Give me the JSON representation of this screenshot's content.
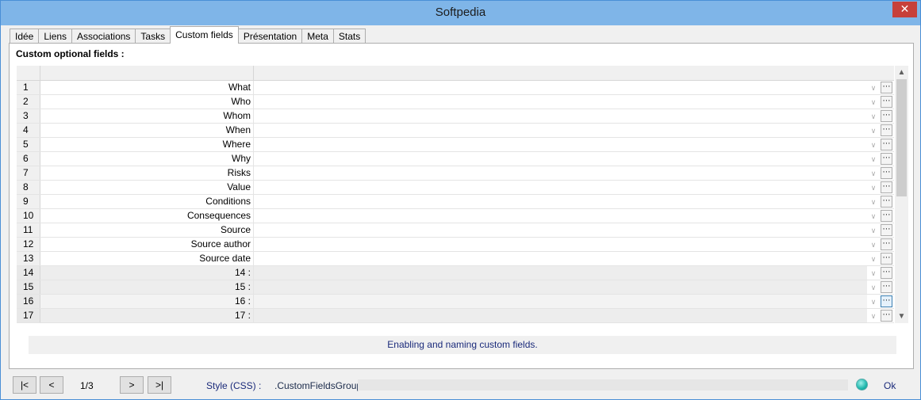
{
  "window": {
    "title": "Softpedia",
    "close_glyph": "✕"
  },
  "tabs": [
    {
      "label": "Idée",
      "active": false
    },
    {
      "label": "Liens",
      "active": false
    },
    {
      "label": "Associations",
      "active": false
    },
    {
      "label": "Tasks",
      "active": false
    },
    {
      "label": "Custom fields",
      "active": true
    },
    {
      "label": "Présentation",
      "active": false
    },
    {
      "label": "Meta",
      "active": false
    },
    {
      "label": "Stats",
      "active": false
    }
  ],
  "panel": {
    "section_label": "Custom optional fields :",
    "rows": [
      {
        "num": "1",
        "name": "What"
      },
      {
        "num": "2",
        "name": "Who"
      },
      {
        "num": "3",
        "name": "Whom"
      },
      {
        "num": "4",
        "name": "When"
      },
      {
        "num": "5",
        "name": "Where"
      },
      {
        "num": "6",
        "name": "Why"
      },
      {
        "num": "7",
        "name": "Risks"
      },
      {
        "num": "8",
        "name": "Value"
      },
      {
        "num": "9",
        "name": "Conditions"
      },
      {
        "num": "10",
        "name": "Consequences"
      },
      {
        "num": "11",
        "name": "Source"
      },
      {
        "num": "12",
        "name": "Source author"
      },
      {
        "num": "13",
        "name": "Source date"
      },
      {
        "num": "14",
        "name": "14 :"
      },
      {
        "num": "15",
        "name": "15 :"
      },
      {
        "num": "16",
        "name": "16 :"
      },
      {
        "num": "17",
        "name": "17 :"
      }
    ],
    "info_text": "Enabling and naming custom fields."
  },
  "bottom": {
    "first_label": "|<",
    "prev_label": "<",
    "page_info": "1/3",
    "next_label": ">",
    "last_label": ">|",
    "style_label": "Style (CSS) :",
    "style_value": ".CustomFieldsGroup",
    "ok_label": "Ok"
  },
  "icons": {
    "dropdown": "chevron-down-icon",
    "ellipsis": "ellipsis-icon",
    "scroll_up": "chevron-up-icon",
    "scroll_down": "chevron-down-icon",
    "status": "status-led-icon"
  },
  "colors": {
    "titlebar": "#7fb5e8",
    "close": "#c7403a",
    "status_led": "#1fb8ad",
    "link_text": "#1a2a7a"
  }
}
